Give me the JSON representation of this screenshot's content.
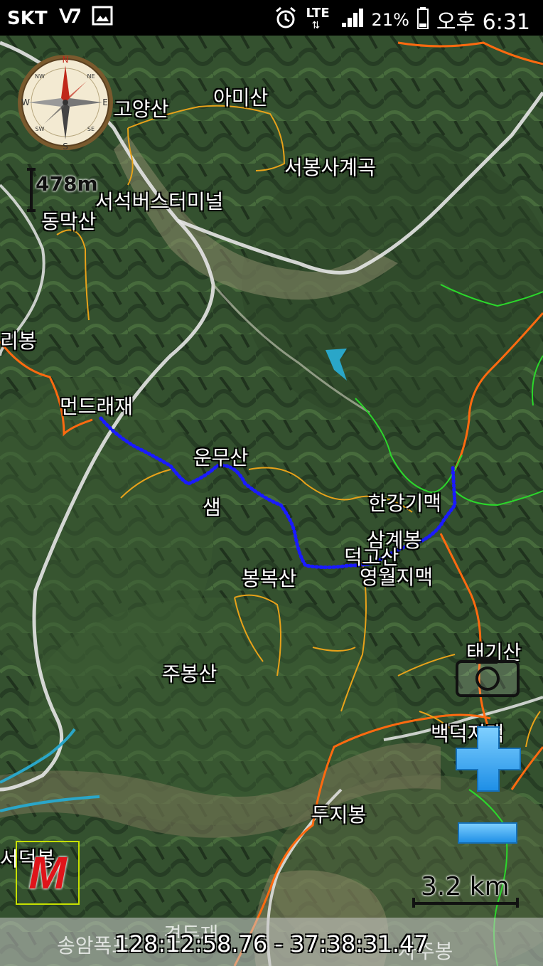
{
  "status_bar": {
    "carrier": "SKT",
    "network": "LTE",
    "battery": "21%",
    "time": "오후 6:31",
    "icons": [
      "vzw-icon",
      "image-icon",
      "alarm-icon",
      "signal-icon",
      "battery-icon"
    ]
  },
  "map": {
    "place_labels": [
      "고양산",
      "아미산",
      "서봉사계곡",
      "서석버스터미널",
      "동막산",
      "리봉",
      "먼드래재",
      "운무산",
      "샘",
      "한강기맥",
      "삼계봉",
      "덕고산",
      "봉복산",
      "영월지맥",
      "주봉산",
      "태기산",
      "백덕지맥",
      "두지봉",
      "서덕봉",
      "송암폭포",
      "견두재",
      "사주봉"
    ],
    "scale_short": "478m",
    "scale_long": "3.2 km",
    "coordinates": "128:12:58.76 - 37:38:31.47",
    "compass_letters": [
      "N",
      "S",
      "E",
      "W",
      "NE",
      "SW",
      "SE",
      "NW"
    ],
    "menu_button_label": "M",
    "colors": {
      "route": "#1a1aff",
      "trail": "#e8a21a",
      "boundary": "#ff6a10",
      "ridge_green": "#2bd82b",
      "road": "#e8e8e8",
      "river": "#2aa6c8"
    }
  },
  "controls": {
    "camera_icon": "camera-icon",
    "zoom_in_icon": "plus-icon",
    "zoom_out_icon": "minus-icon"
  }
}
